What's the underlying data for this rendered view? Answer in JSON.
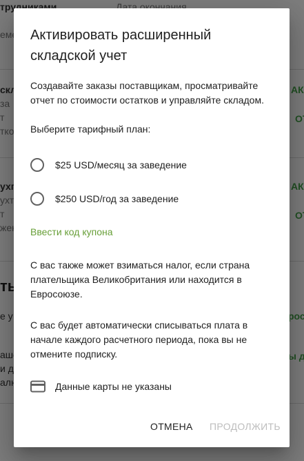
{
  "background": {
    "header_col1": "трудниками",
    "header_col2": "Дата окончания",
    "row1_left": "еме",
    "row2_left": [
      "скла",
      "за",
      "т",
      "тко"
    ],
    "row2_right": [
      "АКТИ",
      "ОТ"
    ],
    "row3_left": [
      "ухга",
      "ухте",
      "т",
      "жен"
    ],
    "row3_right": [
      "АКТИ",
      "ОТ"
    ],
    "section_big": "ть",
    "row4_left": "е у",
    "row4_right": "росс",
    "row5_left": [
      "аше",
      "и д",
      "алю"
    ],
    "row5_right": "ы д"
  },
  "dialog": {
    "title": "Активировать расширенный складской учет",
    "description": "Создавайте заказы поставщикам, просматривайте отчет по стоимости остатков и управляйте складом.",
    "plan_label": "Выберите тарифный план:",
    "plans": [
      {
        "label": "$25 USD/месяц за заведение",
        "selected": false
      },
      {
        "label": "$250 USD/год за заведение",
        "selected": false
      }
    ],
    "coupon_link": "Ввести код купона",
    "tax_note": "С вас также может взиматься налог, если страна плательщика Великобритания или находится в Евросоюзе.",
    "billing_note": "С вас будет автоматически списываться плата в начале каждого расчетного периода, пока вы не отмените подписку.",
    "card_label": "Данные карты не указаны",
    "card_icon": "credit-card-icon",
    "cancel_label": "ОТМЕНА",
    "continue_label": "ПРОДОЛЖИТЬ"
  },
  "colors": {
    "accent_green": "#689f38",
    "disabled_text": "#bdbdbd",
    "scrim": "rgba(0,0,0,0.5)"
  }
}
